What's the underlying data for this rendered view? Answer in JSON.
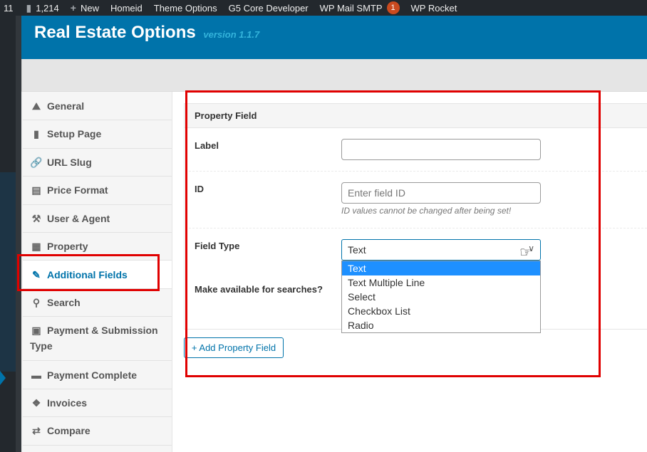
{
  "adminbar": {
    "item_first": "11",
    "comments_count": "1,214",
    "new_label": "New",
    "site_name": "Homeid",
    "theme_options": "Theme Options",
    "g5_core": "G5 Core Developer",
    "wp_mail_smtp": "WP Mail SMTP",
    "wp_mail_smtp_badge": "1",
    "wp_rocket": "WP Rocket"
  },
  "header": {
    "title": "Real Estate Options",
    "version": "version 1.1.7"
  },
  "sidebar": {
    "items": [
      {
        "label": "General",
        "icon": "building-icon"
      },
      {
        "label": "Setup Page",
        "icon": "pages-icon"
      },
      {
        "label": "URL Slug",
        "icon": "link-icon"
      },
      {
        "label": "Price Format",
        "icon": "money-icon"
      },
      {
        "label": "User & Agent",
        "icon": "wrench-icon"
      },
      {
        "label": "Property",
        "icon": "building-grid-icon"
      },
      {
        "label": "Additional Fields",
        "icon": "note-icon",
        "active": true
      },
      {
        "label": "Search",
        "icon": "search-icon"
      },
      {
        "label": "Payment & Submission Type",
        "icon": "cart-icon"
      },
      {
        "label": "Payment Complete",
        "icon": "card-icon"
      },
      {
        "label": "Invoices",
        "icon": "tag-icon"
      },
      {
        "label": "Compare",
        "icon": "exchange-icon"
      }
    ]
  },
  "panel": {
    "title": "Property Field",
    "label_field": {
      "label": "Label",
      "value": ""
    },
    "id_field": {
      "label": "ID",
      "placeholder": "Enter field ID",
      "hint": "ID values cannot be changed after being set!"
    },
    "field_type": {
      "label": "Field Type",
      "value": "Text",
      "options": [
        "Text",
        "Text Multiple Line",
        "Select",
        "Checkbox List",
        "Radio"
      ]
    },
    "searchable": {
      "label": "Make available for searches?"
    }
  },
  "add_button": "+ Add Property Field",
  "colors": {
    "accent": "#0073aa",
    "admin_bar": "#23282d",
    "annotation_red": "#e00000",
    "option_highlight": "#1e90ff",
    "badge": "#ca4a1f"
  }
}
